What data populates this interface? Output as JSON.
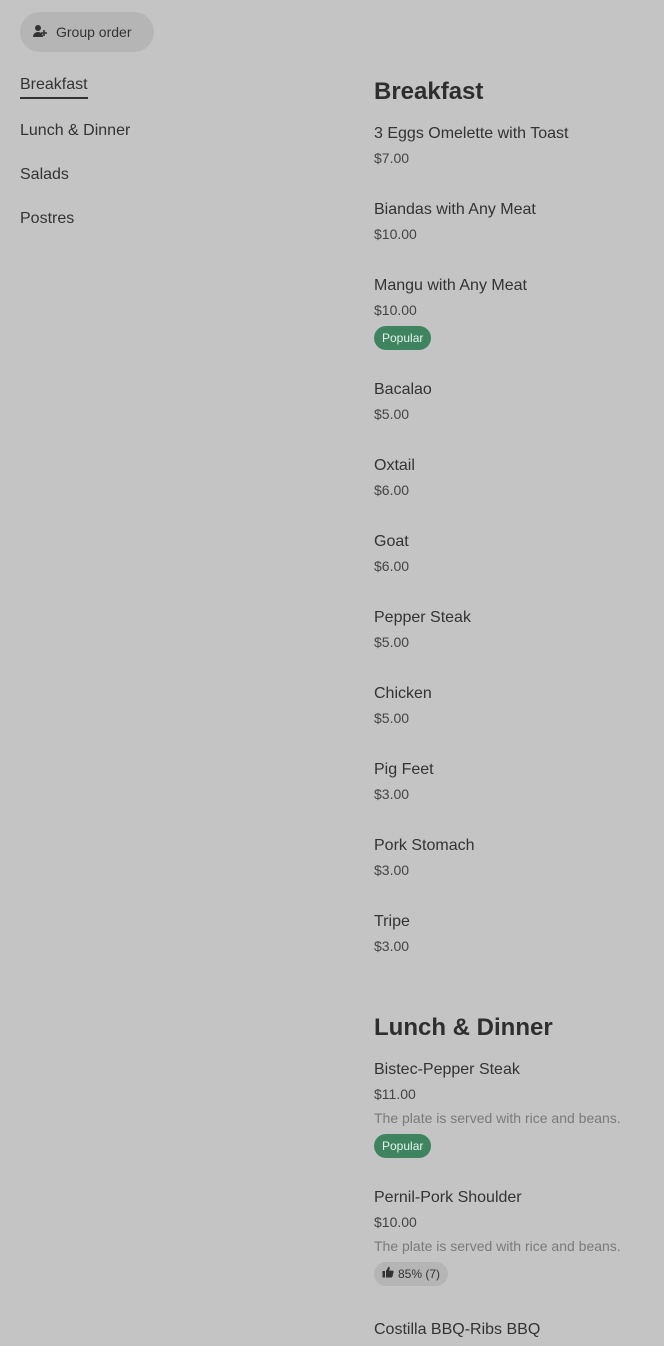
{
  "group_order": {
    "label": "Group order",
    "icon": "person-add-icon"
  },
  "categories": [
    {
      "label": "Breakfast",
      "active": true
    },
    {
      "label": "Lunch & Dinner"
    },
    {
      "label": "Salads"
    },
    {
      "label": "Postres"
    }
  ],
  "sections": [
    {
      "title": "Breakfast",
      "items": [
        {
          "name": "3 Eggs Omelette with Toast",
          "price": "$7.00"
        },
        {
          "name": "Biandas with Any Meat",
          "price": "$10.00"
        },
        {
          "name": "Mangu with Any Meat",
          "price": "$10.00",
          "badge": "Popular"
        },
        {
          "name": "Bacalao",
          "price": "$5.00"
        },
        {
          "name": "Oxtail",
          "price": "$6.00"
        },
        {
          "name": "Goat",
          "price": "$6.00"
        },
        {
          "name": "Pepper Steak",
          "price": "$5.00"
        },
        {
          "name": "Chicken",
          "price": "$5.00"
        },
        {
          "name": "Pig Feet",
          "price": "$3.00"
        },
        {
          "name": "Pork Stomach",
          "price": "$3.00"
        },
        {
          "name": "Tripe",
          "price": "$3.00"
        }
      ]
    },
    {
      "title": "Lunch & Dinner",
      "items": [
        {
          "name": "Bistec-Pepper Steak",
          "price": "$11.00",
          "description": "The plate is served with rice and beans.",
          "badge": "Popular"
        },
        {
          "name": "Pernil-Pork Shoulder",
          "price": "$10.00",
          "description": "The plate is served with rice and beans.",
          "rating": "85% (7)"
        },
        {
          "name": "Costilla BBQ-Ribs BBQ"
        }
      ]
    }
  ]
}
